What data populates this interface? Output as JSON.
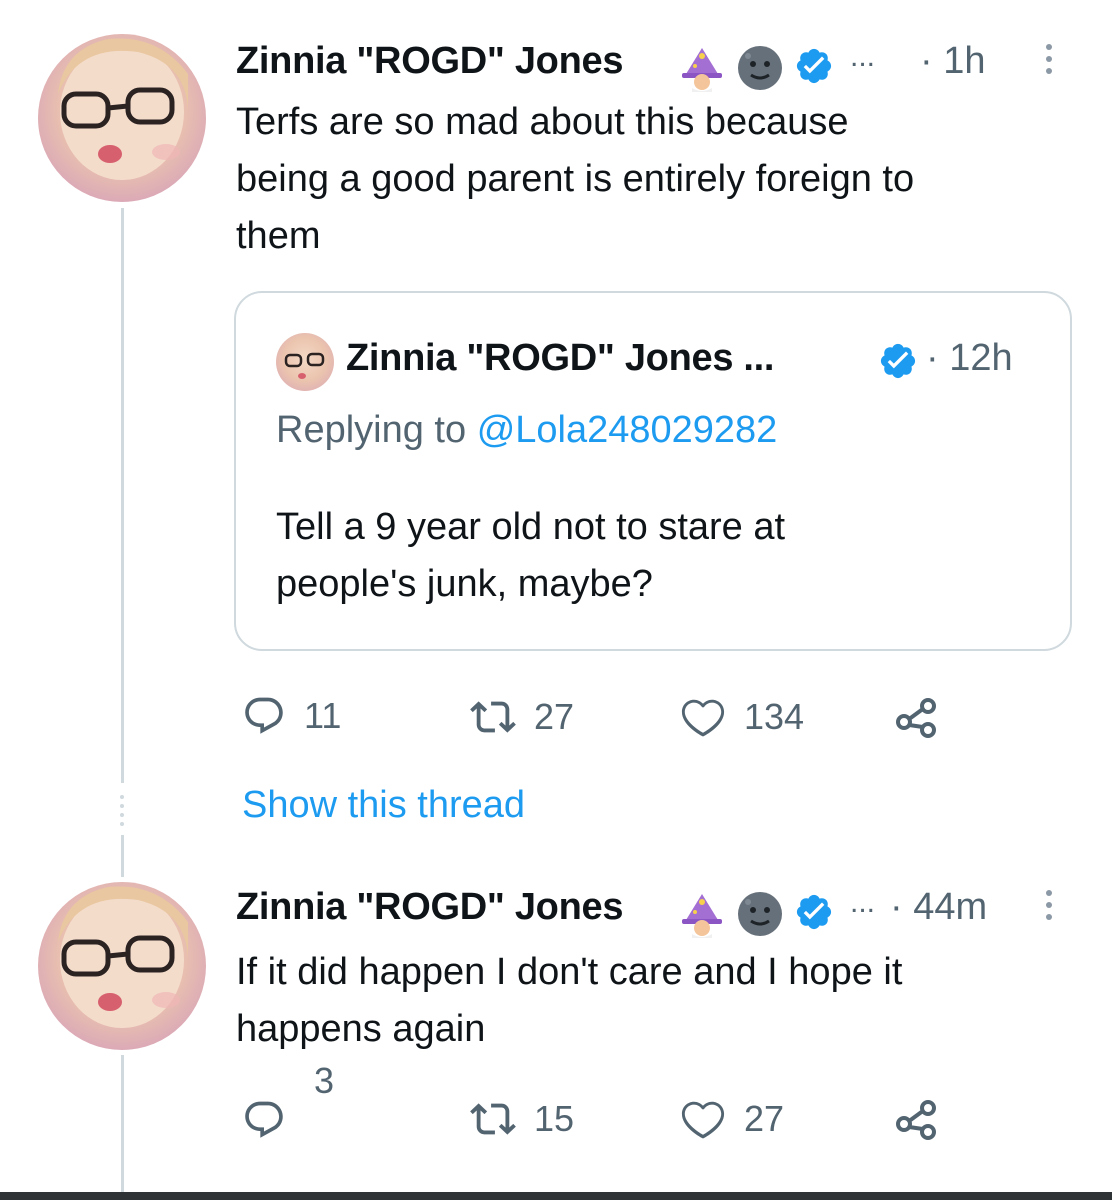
{
  "tweet1": {
    "author": "Zinnia \"ROGD\" Jones",
    "ellipsis": "...",
    "time": "· 1h",
    "text_lines": [
      "Terfs are so mad about this because",
      "being a good parent is entirely foreign to",
      "them"
    ],
    "quote": {
      "author": "Zinnia \"ROGD\" Jones ...",
      "time": "· 12h",
      "replying_prefix": "Replying to",
      "replying_handle": "@Lola248029282",
      "text_lines": [
        "Tell a 9 year old not to stare at",
        "people's junk, maybe?"
      ]
    },
    "actions": {
      "replies": "11",
      "retweets": "27",
      "likes": "134"
    },
    "show_thread": "Show this thread"
  },
  "tweet2": {
    "author": "Zinnia \"ROGD\" Jones",
    "ellipsis": "...",
    "time": "· 44m",
    "text_lines": [
      "If it did happen I don't care and I hope it",
      "happens again"
    ],
    "actions": {
      "replies": "3",
      "retweets": "15",
      "likes": "27"
    }
  },
  "colors": {
    "text": "#0f1419",
    "muted": "#536471",
    "link": "#1d9bf0",
    "verified": "#1d9bf0",
    "border": "#cfd9de"
  },
  "icons": [
    "wizard-emoji-icon",
    "moon-face-emoji-icon",
    "verified-badge-icon",
    "more-options-icon",
    "reply-icon",
    "retweet-icon",
    "like-icon",
    "share-icon"
  ]
}
